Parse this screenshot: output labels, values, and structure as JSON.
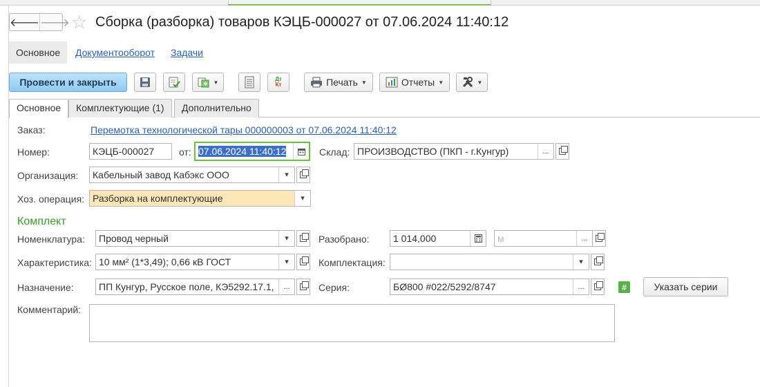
{
  "window": {
    "title": "Сборка (разборка) товаров КЭЦБ-000027 от 07.06.2024 11:40:12",
    "back_glyph": "🡐",
    "forward_glyph": "🡒",
    "star_glyph": "☆"
  },
  "nav_tabs": [
    {
      "label": "Основное"
    },
    {
      "label": "Документооборот"
    },
    {
      "label": "Задачи"
    }
  ],
  "toolbar": {
    "post_close_label": "Провести и закрыть",
    "print_label": "Печать",
    "reports_label": "Отчеты",
    "dtkt_top": "Дт",
    "dtkt_bottom": "Кт"
  },
  "form_tabs": [
    {
      "label": "Основное"
    },
    {
      "label": "Комплектующие (1)"
    },
    {
      "label": "Дополнительно"
    }
  ],
  "form": {
    "order_label": "Заказ:",
    "order_link": "Перемотка технологической тары 000000003 от 07.06.2024 11:40:12",
    "number_label": "Номер:",
    "number_value": "КЭЦБ-000027",
    "date_label": "от:",
    "date_value": "07.06.2024 11:40:12",
    "warehouse_label": "Склад:",
    "warehouse_value": "ПРОИЗВОДСТВО (ПКП - г.Кунгур)",
    "org_label": "Организация:",
    "org_value": "Кабельный завод Кабэкс ООО",
    "operation_label": "Хоз. операция:",
    "operation_value": "Разборка на комплектующие",
    "section_title": "Комплект",
    "nomenclature_label": "Номенклатура:",
    "nomenclature_value": "Провод черный",
    "disassembled_label": "Разобрано:",
    "disassembled_value": "1 014,000",
    "unit_placeholder": "м",
    "characteristic_label": "Характеристика:",
    "characteristic_value": "10 мм² (1*3,49); 0,66 кВ ГОСТ",
    "kit_label": "Комплектация:",
    "kit_value": "",
    "purpose_label": "Назначение:",
    "purpose_value": "ПП Кунгур, Русское поле, КЭ5292.17.1,",
    "series_label": "Серия:",
    "series_value": "БØ800 #022/5292/8747",
    "series_hash": "#",
    "specify_series_label": "Указать серии",
    "comment_label": "Комментарий:",
    "comment_value": "",
    "select_glyph": "...",
    "dropdown_glyph": "▾"
  }
}
